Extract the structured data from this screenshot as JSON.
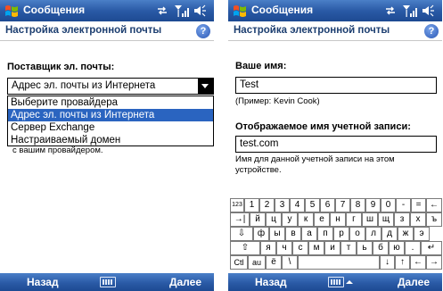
{
  "left": {
    "app_title": "Сообщения",
    "page_title": "Настройка электронной почты",
    "help": "?",
    "provider_label": "Поставщик эл. почты:",
    "provider_selected": "Адрес эл. почты из Интернета",
    "dropdown": [
      {
        "label": "Выберите провайдера",
        "selected": false
      },
      {
        "label": "Адрес эл. почты из Интернета",
        "selected": true
      },
      {
        "label": "Сервер Exchange",
        "selected": false
      },
      {
        "label": "Настраиваемый домен",
        "selected": false
      }
    ],
    "hint": "с вашим провайдером.",
    "softkey_left": "Назад",
    "softkey_right": "Далее"
  },
  "right": {
    "app_title": "Сообщения",
    "page_title": "Настройка электронной почты",
    "help": "?",
    "name_label": "Ваше имя:",
    "name_value": "Test",
    "name_example": "(Пример: Kevin Cook)",
    "display_label": "Отображаемое имя учетной записи:",
    "display_value": "test.com",
    "display_hint_1": "Имя для данной учетной записи на этом",
    "display_hint_2": "устройстве.",
    "softkey_left": "Назад",
    "softkey_right": "Далее"
  },
  "keyboard": {
    "rows": [
      [
        "123",
        "1",
        "2",
        "3",
        "4",
        "5",
        "6",
        "7",
        "8",
        "9",
        "0",
        "-",
        "=",
        "←"
      ],
      [
        "→|",
        "й",
        "ц",
        "у",
        "к",
        "е",
        "н",
        "г",
        "ш",
        "щ",
        "з",
        "х",
        "ъ"
      ],
      [
        "⇩",
        "ф",
        "ы",
        "в",
        "а",
        "п",
        "р",
        "о",
        "л",
        "д",
        "ж",
        "э"
      ],
      [
        "⇧",
        "я",
        "ч",
        "с",
        "м",
        "и",
        "т",
        "ь",
        "б",
        "ю",
        ".",
        "↵"
      ],
      [
        "Ctl",
        "au",
        "ё",
        "\\",
        "",
        "↓",
        "↑",
        "←",
        "→"
      ]
    ]
  },
  "colors": {
    "titlebar": "#2a5aa6",
    "selection": "#2a64c0",
    "page_title": "#1c3e70"
  },
  "icons": {
    "start": "windows-flag-icon",
    "connectivity": "sync-arrows-icon",
    "signal": "signal-icon",
    "volume": "speaker-icon",
    "help": "help-icon",
    "keyboard": "keyboard-icon"
  }
}
